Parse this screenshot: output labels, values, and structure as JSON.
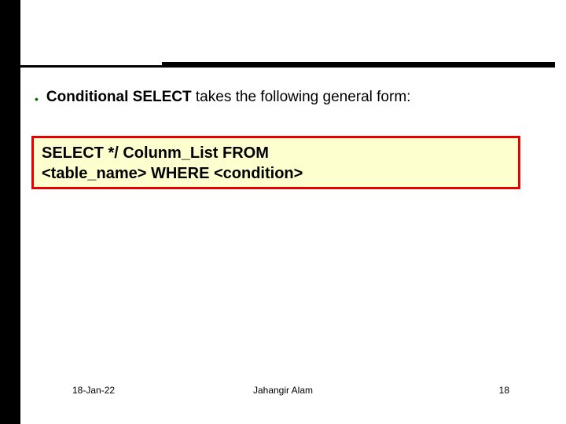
{
  "bullet": {
    "bold": "Conditional SELECT",
    "rest": " takes the following general form:"
  },
  "code": {
    "line1": "SELECT */ Colunm_List FROM",
    "line2": "<table_name> WHERE <condition>"
  },
  "footer": {
    "date": "18-Jan-22",
    "author": "Jahangir Alam",
    "page": "18"
  }
}
